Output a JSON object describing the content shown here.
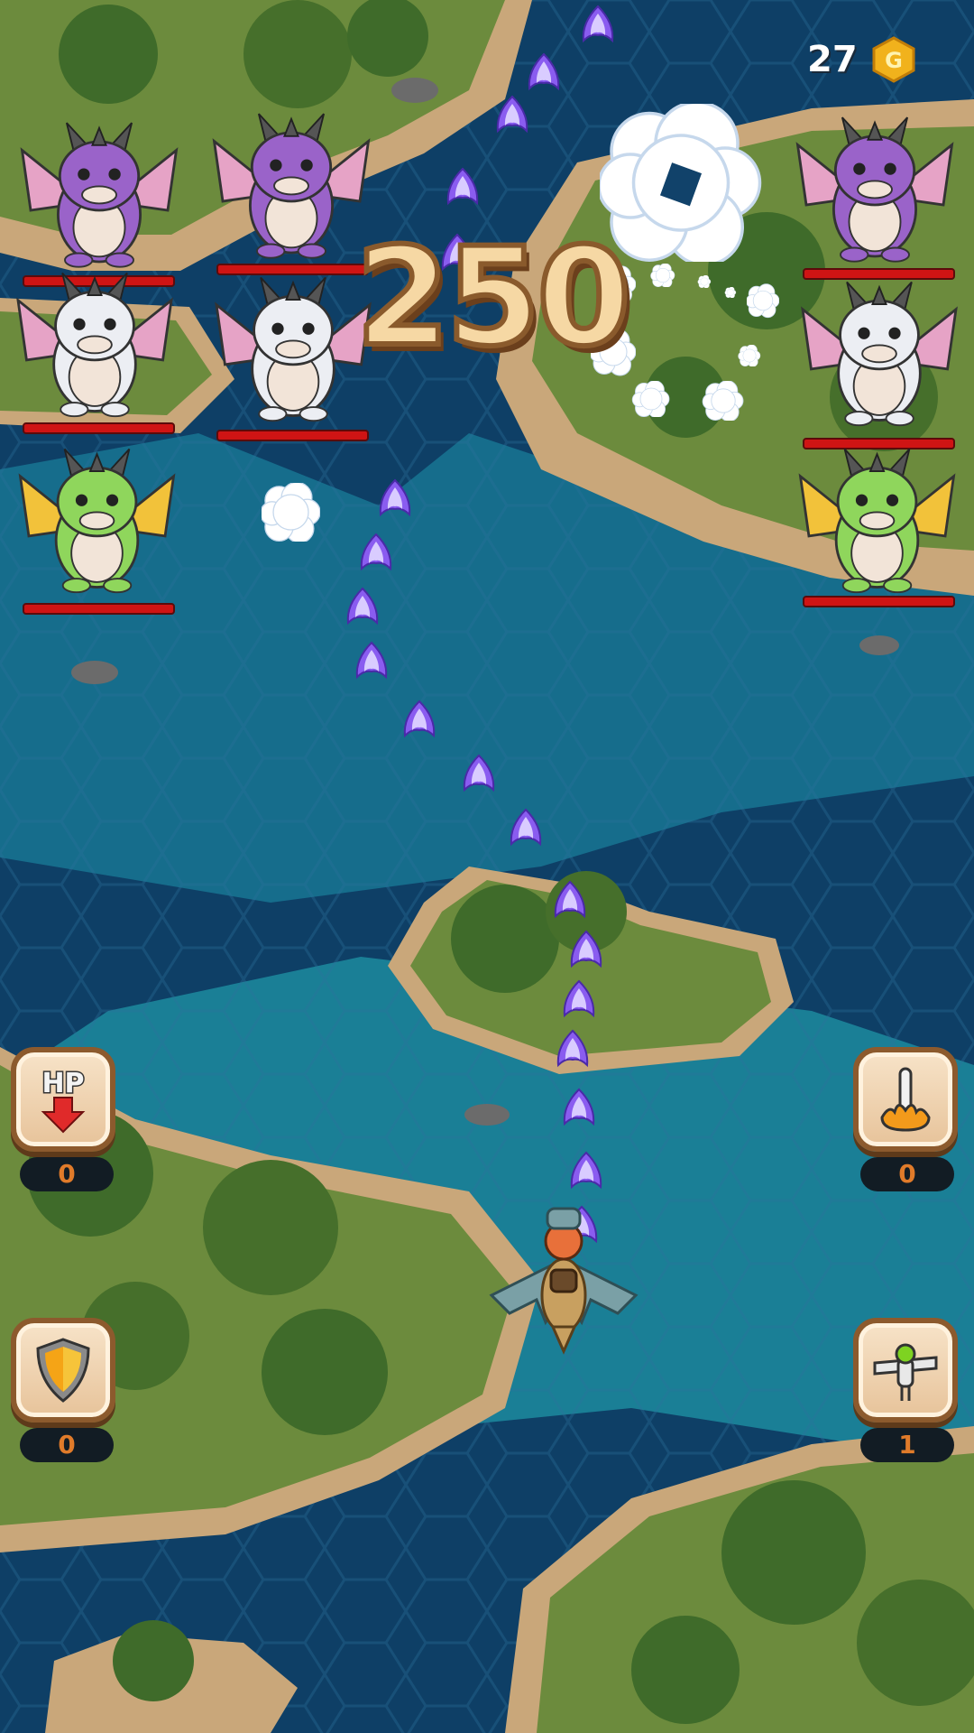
{
  "hud": {
    "coins": "27",
    "coin_icon": "gold-coin-icon",
    "coin_letter": "G",
    "score": "250"
  },
  "powerups": [
    {
      "id": "hp",
      "icon": "hp-down-icon",
      "label": "HP",
      "count": "0"
    },
    {
      "id": "boost",
      "icon": "rocket-flame-icon",
      "count": "0"
    },
    {
      "id": "shield",
      "icon": "shield-icon",
      "count": "0"
    },
    {
      "id": "wingman",
      "icon": "wingman-drone-icon",
      "count": "1"
    }
  ],
  "enemies": [
    {
      "type": "purple-dragon",
      "health": 1.0
    },
    {
      "type": "purple-dragon",
      "health": 1.0
    },
    {
      "type": "purple-dragon",
      "health": 1.0
    },
    {
      "type": "white-dragon",
      "health": 1.0
    },
    {
      "type": "white-dragon",
      "health": 1.0
    },
    {
      "type": "white-dragon",
      "health": 1.0
    },
    {
      "type": "green-dragon",
      "health": 1.0
    },
    {
      "type": "green-dragon",
      "health": 1.0
    }
  ],
  "player": {
    "type": "dragon-rider"
  },
  "colors": {
    "purple_dragon": "#9a63c9",
    "white_dragon": "#eceef3",
    "green_dragon": "#8fd65c",
    "health_bar": "#cf1414",
    "bullet": "#8a5cf0",
    "score_fill": "#f6d8a4",
    "deep_water": "#0e3f66",
    "shallow_water": "#1f8fa0",
    "sand": "#c9a77a",
    "grass": "#6c8b3d"
  }
}
